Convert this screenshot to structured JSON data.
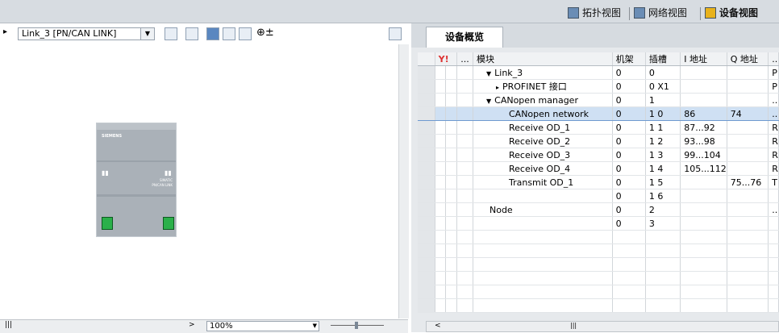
{
  "view_tabs": {
    "topology": "拓扑视图",
    "network": "网络视图",
    "device": "设备视图"
  },
  "toolbar": {
    "device_selector": "Link_3 [PN/CAN LINK]",
    "zoom": "100%"
  },
  "module": {
    "brand": "SIEMENS",
    "label_line1": "SIMATIC",
    "label_line2": "PN/CAN LINK"
  },
  "overview_tab": "设备概览",
  "table": {
    "headers": [
      "...",
      "模块",
      "机架",
      "插槽",
      "I 地址",
      "Q 地址",
      ".."
    ],
    "rows": [
      {
        "module": "Link_3",
        "rack": "0",
        "slot": "0",
        "i": "",
        "q": "",
        "x": "P"
      },
      {
        "module": "PROFINET 接口",
        "rack": "0",
        "slot": "0 X1",
        "i": "",
        "q": "",
        "x": "P"
      },
      {
        "module": "CANopen manager",
        "rack": "0",
        "slot": "1",
        "i": "",
        "q": "",
        "x": ".."
      },
      {
        "module": "CANopen network",
        "rack": "0",
        "slot": "1 0",
        "i": "86",
        "q": "74",
        "x": ".."
      },
      {
        "module": "Receive OD_1",
        "rack": "0",
        "slot": "1 1",
        "i": "87...92",
        "q": "",
        "x": "R"
      },
      {
        "module": "Receive OD_2",
        "rack": "0",
        "slot": "1 2",
        "i": "93...98",
        "q": "",
        "x": "R"
      },
      {
        "module": "Receive OD_3",
        "rack": "0",
        "slot": "1 3",
        "i": "99...104",
        "q": "",
        "x": "R"
      },
      {
        "module": "Receive OD_4",
        "rack": "0",
        "slot": "1 4",
        "i": "105...112",
        "q": "",
        "x": "R"
      },
      {
        "module": "Transmit OD_1",
        "rack": "0",
        "slot": "1 5",
        "i": "",
        "q": "75...76",
        "x": "T"
      },
      {
        "module": "",
        "rack": "0",
        "slot": "1 6",
        "i": "",
        "q": "",
        "x": ""
      },
      {
        "module": "Node",
        "rack": "0",
        "slot": "2",
        "i": "",
        "q": "",
        "x": ".."
      },
      {
        "module": "",
        "rack": "0",
        "slot": "3",
        "i": "",
        "q": "",
        "x": ""
      },
      {
        "module": "",
        "rack": "",
        "slot": "",
        "i": "",
        "q": "",
        "x": ""
      },
      {
        "module": "",
        "rack": "",
        "slot": "",
        "i": "",
        "q": "",
        "x": ""
      },
      {
        "module": "",
        "rack": "",
        "slot": "",
        "i": "",
        "q": "",
        "x": ""
      },
      {
        "module": "",
        "rack": "",
        "slot": "",
        "i": "",
        "q": "",
        "x": ""
      },
      {
        "module": "",
        "rack": "",
        "slot": "",
        "i": "",
        "q": "",
        "x": ""
      },
      {
        "module": "",
        "rack": "",
        "slot": "",
        "i": "",
        "q": "",
        "x": ""
      }
    ]
  },
  "colors": {
    "selection": "#cfe0f3",
    "port_green": "#2bb04a"
  }
}
